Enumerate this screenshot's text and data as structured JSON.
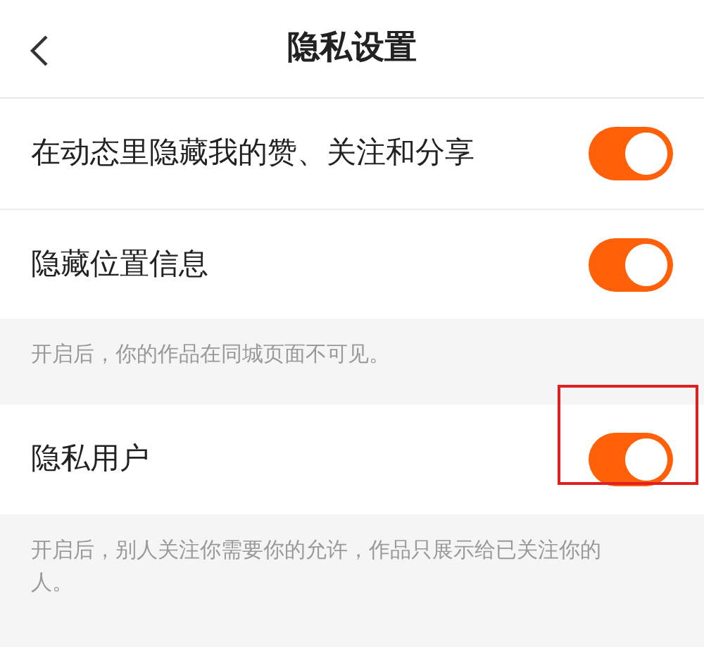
{
  "header": {
    "title": "隐私设置"
  },
  "sections": [
    {
      "rows": [
        {
          "label": "在动态里隐藏我的赞、关注和分享",
          "on": true,
          "highlighted": false
        },
        {
          "label": "隐藏位置信息",
          "on": true,
          "highlighted": false
        }
      ],
      "note": "开启后，你的作品在同城页面不可见。"
    },
    {
      "rows": [
        {
          "label": "隐私用户",
          "on": true,
          "highlighted": true
        }
      ],
      "note": "开启后，别人关注你需要你的允许，作品只展示给已关注你的人。"
    }
  ]
}
